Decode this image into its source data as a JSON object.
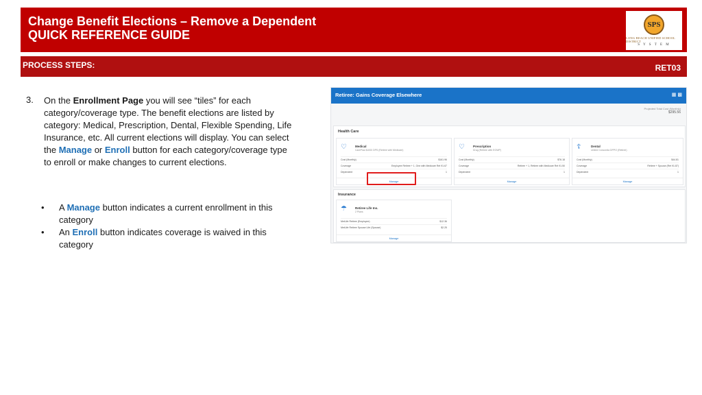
{
  "header": {
    "title": "Change Benefit Elections – Remove a Dependent",
    "subtitle": "QUICK REFERENCE GUIDE",
    "logo_initials": "SPS",
    "logo_text": "LONG BEACH UNIFIED SCHOOL DISTRICT",
    "logo_system": "S Y S T E M"
  },
  "steps_bar": {
    "label": "PROCESS STEPS:",
    "code": "RET03"
  },
  "step": {
    "number": "3.",
    "p1": "On the ",
    "bold1": "Enrollment Page",
    "p2": " you will see “tiles” for each category/coverage type.  The benefit elections are listed by category: Medical, Prescription, Dental, Flexible Spending, Life Insurance, etc. All current elections will display.  You can select the ",
    "manage": "Manage",
    "or": " or ",
    "enroll": "Enroll",
    "p3": " button for each category/coverage type to enroll or make changes to current elections."
  },
  "bullets": [
    {
      "pre": "A ",
      "key": "Manage",
      "post": " button indicates a current enrollment in this category"
    },
    {
      "pre": "An ",
      "key": "Enroll",
      "post": " button indicates coverage is waived in this category"
    }
  ],
  "screenshot": {
    "title": "Retiree: Gains Coverage Elsewhere",
    "projected_label": "Projected Total Cost (Monthly)",
    "projected_amount": "$295.56",
    "health_care": {
      "title": "Health Care",
      "tiles": [
        {
          "name": "Medical",
          "plan": "CarePlus $1000 DPS (Retiree with Medicare)",
          "icon": "heart-icon",
          "rows": [
            {
              "k": "Cost (Monthly)",
              "v": "$161.96"
            },
            {
              "k": "Coverage",
              "v": "Employee Retiree + 1, One with Medicare Ret 91.67"
            },
            {
              "k": "Dependent",
              "v": "1"
            }
          ],
          "button": "Manage"
        },
        {
          "name": "Prescription",
          "plan": "Drug (Retiree with EGWP)",
          "icon": "heart-icon",
          "rows": [
            {
              "k": "Cost (Monthly)",
              "v": "$76.18"
            },
            {
              "k": "Coverage",
              "v": "Retiree + 1, Retiree with Medicare Ret 91.50"
            },
            {
              "k": "Dependent",
              "v": "1"
            }
          ],
          "button": "Manage"
        },
        {
          "name": "Dental",
          "plan": "United Concordia DPPO (Retiree)",
          "icon": "tooth-icon",
          "rows": [
            {
              "k": "Cost (Monthly)",
              "v": "$44.81"
            },
            {
              "k": "Coverage",
              "v": "Retiree + Spouse (Ret 91.87)"
            },
            {
              "k": "Dependent",
              "v": "1"
            }
          ],
          "button": "Manage"
        }
      ]
    },
    "insurance": {
      "title": "Insurance",
      "tiles": [
        {
          "name": "Retiree Life Ins.",
          "plan": "2 Plans",
          "icon": "umbrella-icon",
          "rows": [
            {
              "k": "MetLife Retiree (Employee)",
              "v": "$12.36"
            },
            {
              "k": "MetLife Retiree Spouse Life (Spouse)",
              "v": "$2.25"
            }
          ],
          "button": "Manage"
        }
      ]
    }
  },
  "colors": {
    "header_red": "#c00000",
    "bar_red": "#b01010",
    "link_blue": "#1f6fb5",
    "workday_blue": "#1a73c8",
    "highlight_red": "#e01b1b"
  }
}
